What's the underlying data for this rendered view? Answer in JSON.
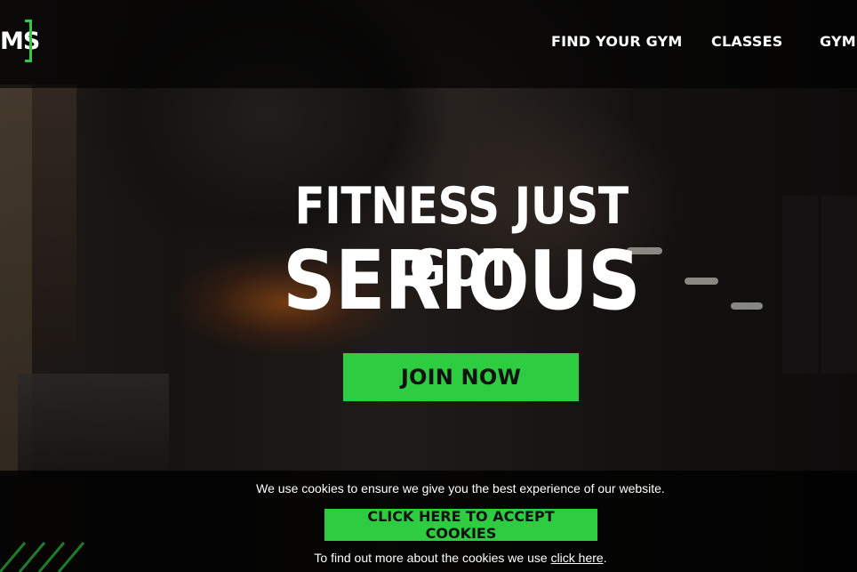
{
  "brand": {
    "logo_text": "MS",
    "accent_color": "#2ecc40"
  },
  "nav": {
    "items": [
      {
        "label": "FIND YOUR GYM"
      },
      {
        "label": "CLASSES"
      },
      {
        "label": "GYM"
      }
    ]
  },
  "hero": {
    "headline_line1": "FITNESS JUST GOT",
    "headline_line2": "SERIOUS",
    "cta_label": "JOIN NOW"
  },
  "cookie_banner": {
    "message": "We use cookies to ensure we give you the best experience of our website.",
    "accept_label": "CLICK HERE TO ACCEPT COOKIES",
    "more_prefix": "To find out more about the cookies we use ",
    "more_link": "click here",
    "more_suffix": "."
  }
}
